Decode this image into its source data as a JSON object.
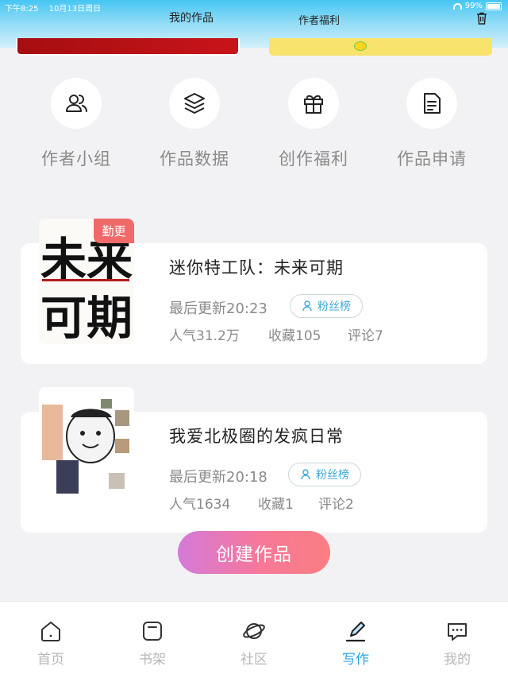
{
  "status_bar": {
    "time": "下午8:25",
    "date": "10月13日周日",
    "battery": "99%"
  },
  "header": {
    "works_title": "我的作品",
    "benefit_title": "作者福利"
  },
  "features": [
    {
      "label": "作者小组",
      "icon": "author-group-icon"
    },
    {
      "label": "作品数据",
      "icon": "layers-icon"
    },
    {
      "label": "创作福利",
      "icon": "gift-icon"
    },
    {
      "label": "作品申请",
      "icon": "application-icon"
    }
  ],
  "works": [
    {
      "title": "迷你特工队：未来可期",
      "badge": "勤更",
      "updated": "最后更新20:23",
      "fans_label": "粉丝榜",
      "popularity": "人气31.2万",
      "favorites": "收藏105",
      "comments": "评论7",
      "cover_text": [
        "未来",
        "可期"
      ]
    },
    {
      "title": "我爱北极圈的发疯日常",
      "updated": "最后更新20:18",
      "fans_label": "粉丝榜",
      "popularity": "人气1634",
      "favorites": "收藏1",
      "comments": "评论2"
    }
  ],
  "create_button": "创建作品",
  "tabs": [
    {
      "label": "首页",
      "icon": "home-icon",
      "active": false
    },
    {
      "label": "书架",
      "icon": "bookshelf-icon",
      "active": false
    },
    {
      "label": "社区",
      "icon": "planet-icon",
      "active": false
    },
    {
      "label": "写作",
      "icon": "pen-icon",
      "active": true
    },
    {
      "label": "我的",
      "icon": "chat-bubble-icon",
      "active": false
    }
  ],
  "colors": {
    "accent": "#2ba4e0",
    "badge": "#f06a6a",
    "header_top": "#46c6f3"
  }
}
